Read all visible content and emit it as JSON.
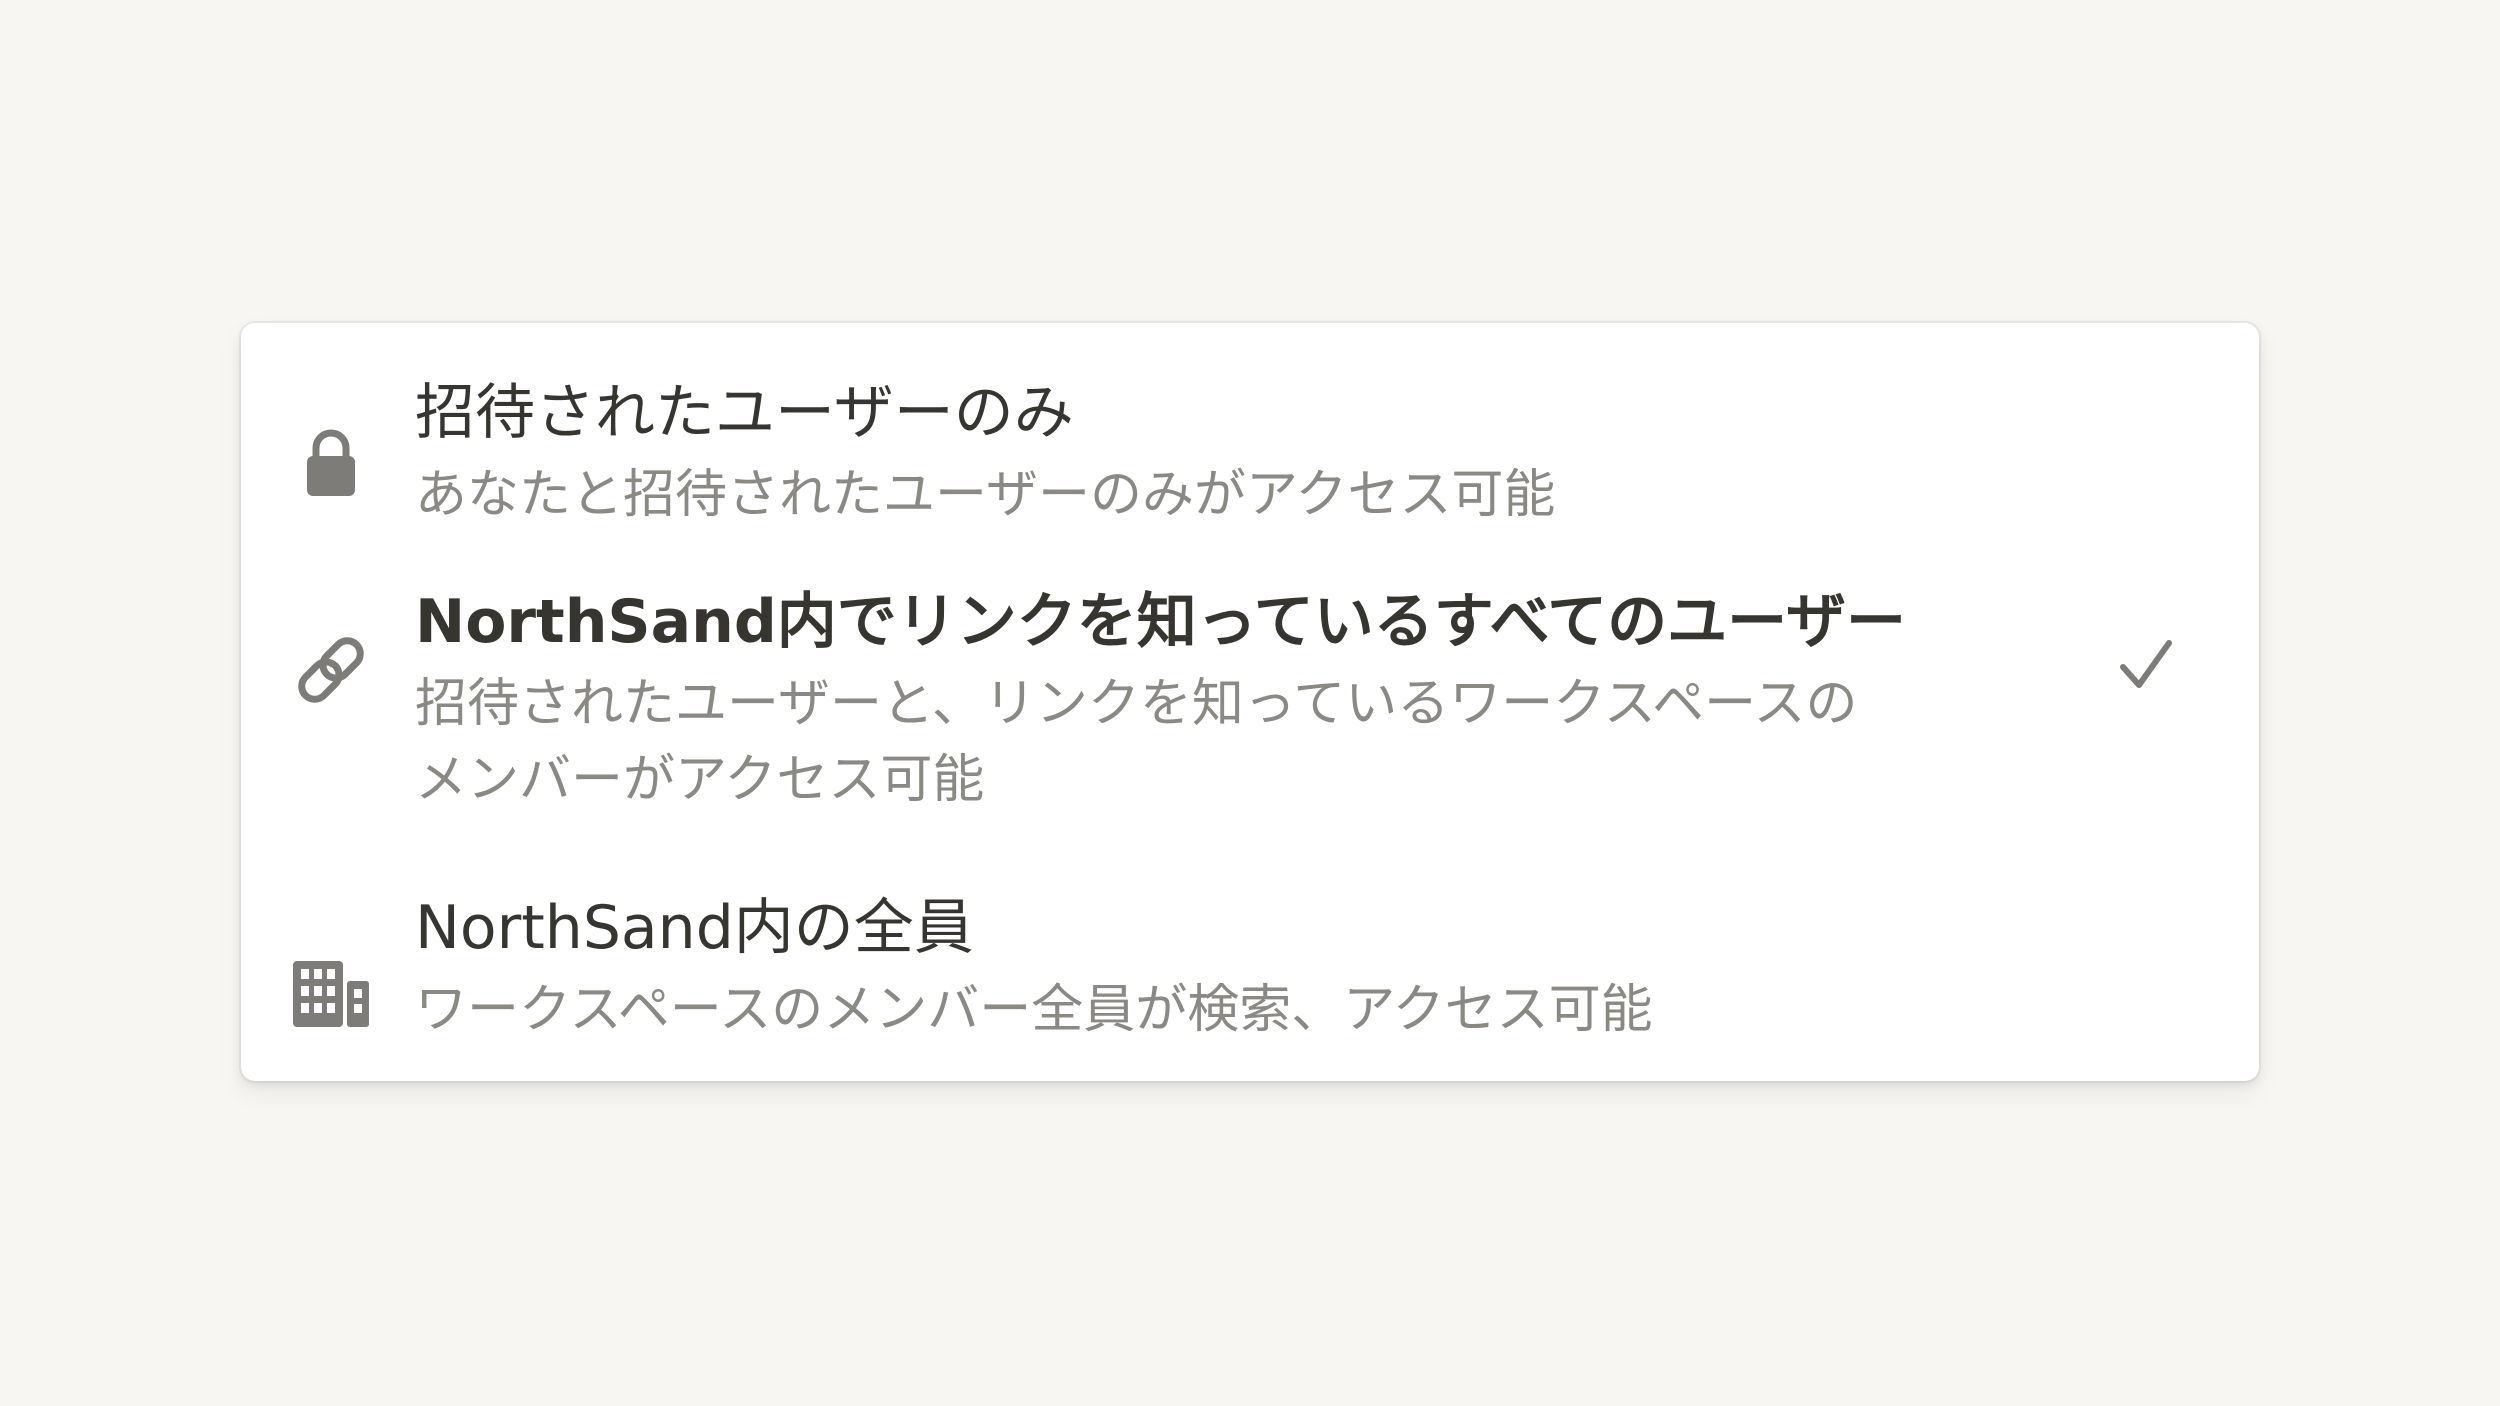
{
  "menu": {
    "options": [
      {
        "icon": "lock-icon",
        "title": "招待されたユーザーのみ",
        "description": "あなたと招待されたユーザーのみがアクセス可能",
        "selected": false
      },
      {
        "icon": "link-icon",
        "title": "NorthSand内でリンクを知っているすべてのユーザー",
        "description_line1": "招待されたユーザーと、リンクを知っているワークスペースの",
        "description_line2": "メンバーがアクセス可能",
        "selected": true
      },
      {
        "icon": "building-icon",
        "title": "NorthSand内の全員",
        "description": "ワークスペースのメンバー全員が検索、アクセス可能",
        "selected": false
      }
    ],
    "selected_indicator_icon": "checkmark-icon"
  },
  "colors": {
    "background": "#f7f6f3",
    "panel": "#ffffff",
    "title_text": "#37352f",
    "description_text": "#8b8983",
    "icon": "#7d7c78"
  }
}
